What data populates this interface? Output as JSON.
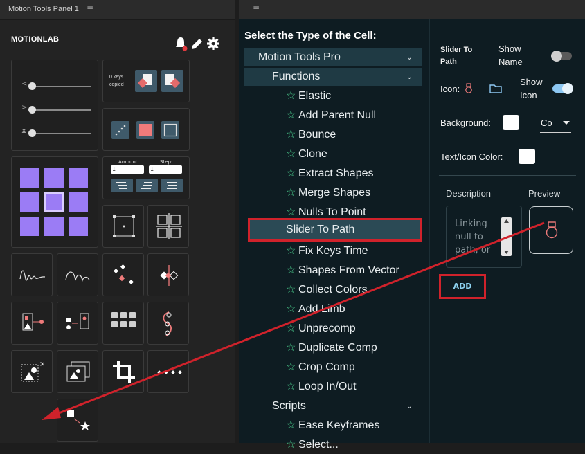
{
  "left_panel": {
    "title": "Motion Tools Panel 1",
    "menu_glyph": "≡",
    "brand": "MOTIONLAB",
    "keys_status": "0 keys\ncopied",
    "amount_label": "Amount:",
    "step_label": "Step:",
    "amount_value": "1",
    "step_value": "1",
    "slider_glyphs": [
      "<",
      ">",
      "⧗"
    ]
  },
  "middle_panel": {
    "menu_glyph": "≡",
    "title": "Select the Type of the Cell:",
    "chevron": "⌄",
    "star": "☆",
    "groups": [
      {
        "label": "Motion Tools Pro"
      },
      {
        "label": "Functions"
      }
    ],
    "functions": [
      "Elastic",
      "Add Parent Null",
      "Bounce",
      "Clone",
      "Extract Shapes",
      "Merge Shapes",
      "Nulls To Point",
      "Slider To Path",
      "Fix Keys Time",
      "Shapes From Vector",
      "Collect Colors",
      "Add Limb",
      "Unprecomp",
      "Duplicate Comp",
      "Crop Comp",
      "Loop In/Out"
    ],
    "selected_index": 7,
    "scripts_label": "Scripts",
    "scripts": [
      "Ease Keyframes",
      "Select..."
    ]
  },
  "right_panel": {
    "slider_to_path": "Slider To\nPath",
    "show_name": "Show\nName",
    "icon_label": "Icon:",
    "show_icon": "Show\nIcon",
    "background_label": "Background:",
    "background_select": "Co",
    "text_icon_color_label": "Text/Icon Color:",
    "description_label": "Description",
    "preview_label": "Preview",
    "description_text": "Linking null to path, or",
    "add_button": "ADD",
    "show_name_on": false,
    "show_icon_on": true
  },
  "colors": {
    "accent_red": "#d0222b",
    "star_green": "#4bd08f",
    "purple": "#9b7cf5",
    "toggle_on": "#8dc8f3"
  }
}
